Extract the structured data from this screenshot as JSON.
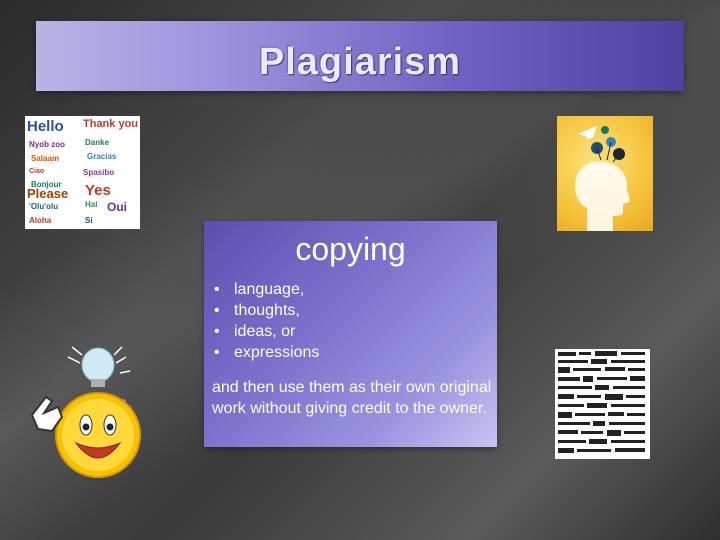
{
  "slide": {
    "title": "Plagiarism",
    "box": {
      "heading": "copying",
      "bullets": [
        "language,",
        "thoughts,",
        "ideas, or",
        "expressions"
      ],
      "text": "and then use them as their own original work without giving credit to the owner."
    },
    "images": {
      "hello_collage": {
        "icon": "multilingual-greetings-collage",
        "words": [
          "Hello",
          "Thank you",
          "Please",
          "Yes",
          "Bonjour",
          "Oui"
        ]
      },
      "head_ideas": {
        "icon": "head-with-ideas-illustration"
      },
      "newspaper": {
        "icon": "newspaper-clippings-icon"
      },
      "smiley": {
        "icon": "smiley-lightbulb-idea-icon"
      }
    },
    "colors": {
      "title_bar": "#6e62c2",
      "box": "#7a70cc",
      "background": "#3a3a3a"
    }
  }
}
